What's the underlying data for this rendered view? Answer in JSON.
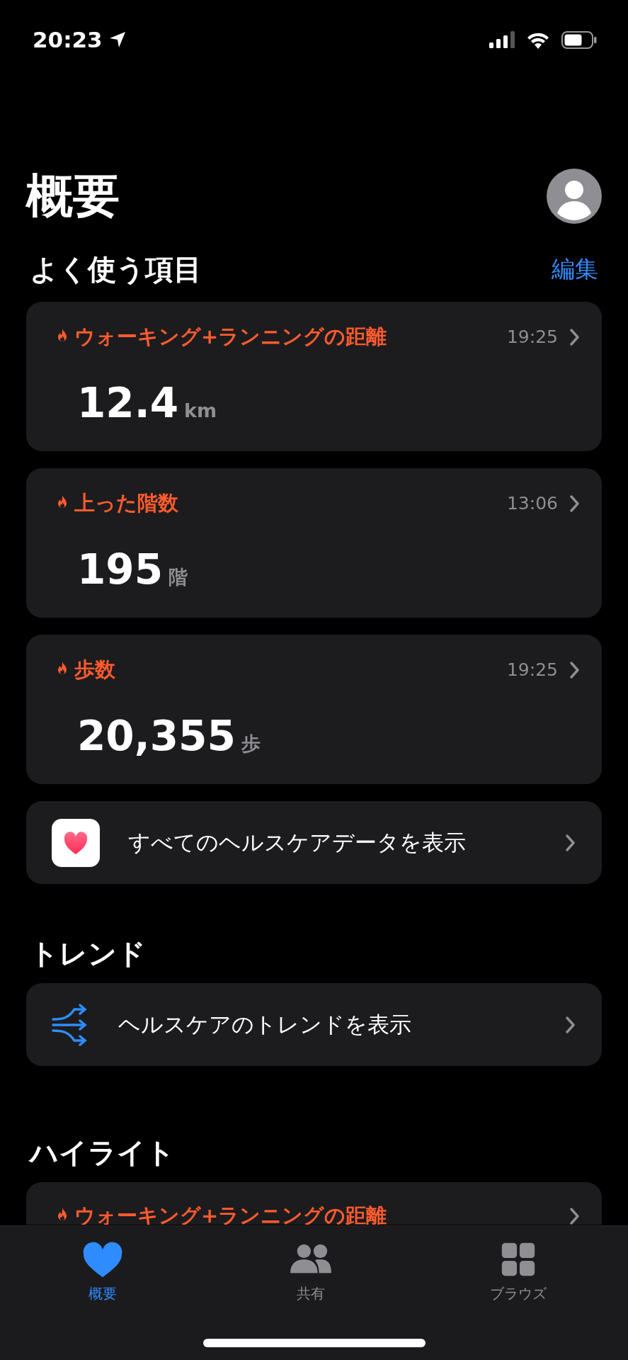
{
  "status_bar": {
    "time": "20:23"
  },
  "header": {
    "title": "概要"
  },
  "favorites": {
    "heading": "よく使う項目",
    "edit_label": "編集",
    "cards": [
      {
        "label": "ウォーキング+ランニングの距離",
        "time": "19:25",
        "value": "12.4",
        "unit": "km"
      },
      {
        "label": "上った階数",
        "time": "13:06",
        "value": "195",
        "unit": "階"
      },
      {
        "label": "歩数",
        "time": "19:25",
        "value": "20,355",
        "unit": "歩"
      }
    ],
    "all_data_link": {
      "label": "すべてのヘルスケアデータを表示"
    }
  },
  "trends": {
    "heading": "トレンド",
    "link": {
      "label": "ヘルスケアのトレンドを表示"
    }
  },
  "highlights": {
    "heading": "ハイライト",
    "cards": [
      {
        "label": "ウォーキング+ランニングの距離"
      }
    ]
  },
  "tab_bar": [
    {
      "label": "概要",
      "selected": true
    },
    {
      "label": "共有",
      "selected": false
    },
    {
      "label": "ブラウズ",
      "selected": false
    }
  ]
}
